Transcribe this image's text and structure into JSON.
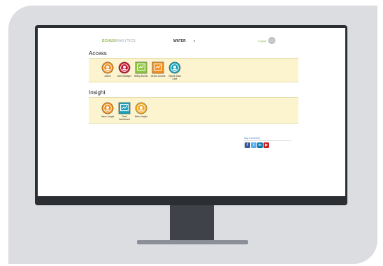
{
  "app": {
    "logo_part1": "ECHUS",
    "logo_part2": "ANALYTICS",
    "environment": "WATER",
    "environment_caret": "▾",
    "logout": "Logout"
  },
  "sections": [
    {
      "title": "Access",
      "tiles": [
        {
          "label": "Admin",
          "icon": "admin-icon",
          "color": "#f28e1c"
        },
        {
          "label": "Alert Manager",
          "icon": "alert-manager-icon",
          "color": "#c4122f"
        },
        {
          "label": "Billing Access",
          "icon": "billing-access-icon",
          "color": "#8dc63f"
        },
        {
          "label": "Device Access",
          "icon": "device-access-icon",
          "color": "#f28e1c"
        },
        {
          "label": "Splunk Data Lake",
          "icon": "data-lake-icon",
          "color": "#1aa2b8"
        }
      ]
    },
    {
      "title": "Insight",
      "tiles": [
        {
          "label": "Alarm Insight",
          "icon": "alarm-insight-icon",
          "color": "#f28e1c"
        },
        {
          "label": "Fleet Dashboard",
          "icon": "fleet-dashboard-icon",
          "color": "#1aa2b8"
        },
        {
          "label": "Meter Insight",
          "icon": "meter-insight-icon",
          "color": "#f7a81b"
        }
      ]
    }
  ],
  "footer": {
    "stay_connected": "Stay Connected",
    "social": [
      {
        "name": "facebook-icon",
        "color": "#3b5998",
        "glyph": "f"
      },
      {
        "name": "twitter-icon",
        "color": "#55acee",
        "glyph": "t"
      },
      {
        "name": "linkedin-icon",
        "color": "#0e76a8",
        "glyph": "in"
      },
      {
        "name": "youtube-icon",
        "color": "#cd201f",
        "glyph": "▶"
      }
    ]
  }
}
